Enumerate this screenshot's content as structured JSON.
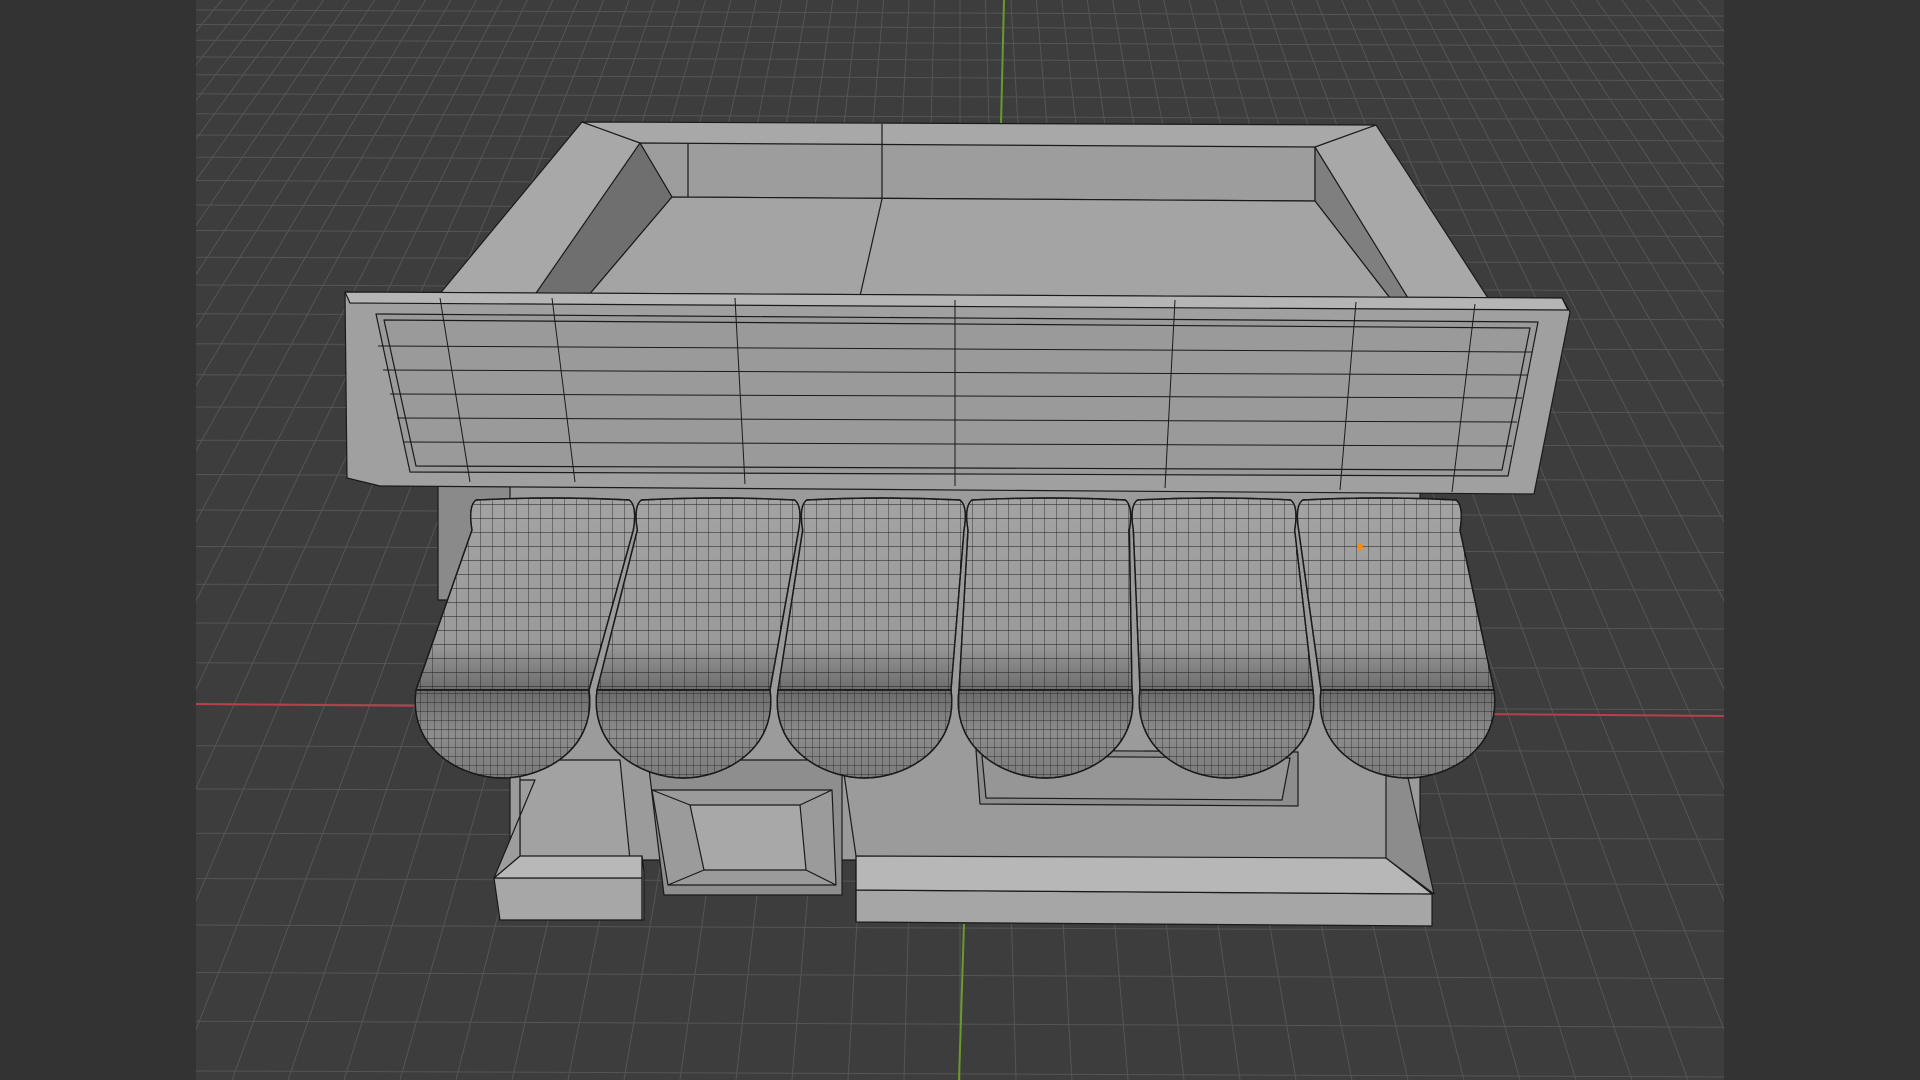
{
  "viewport": {
    "colors": {
      "background": "#3d3d3d",
      "side_bands": "#333333",
      "grid_line": "#555555",
      "x_axis": "#b8404c",
      "y_axis": "#6b9a2a",
      "mesh_fill": "#9a9a9a",
      "mesh_fill_light": "#a9a9a9",
      "mesh_fill_dark": "#7e7e7e",
      "wire": "#1a1a1a",
      "selected_vertex": "#ff8a00"
    },
    "model": {
      "kind": "shop-building",
      "awning_segments": 6,
      "has_sign_board": true,
      "has_door": true,
      "has_window": true
    }
  }
}
